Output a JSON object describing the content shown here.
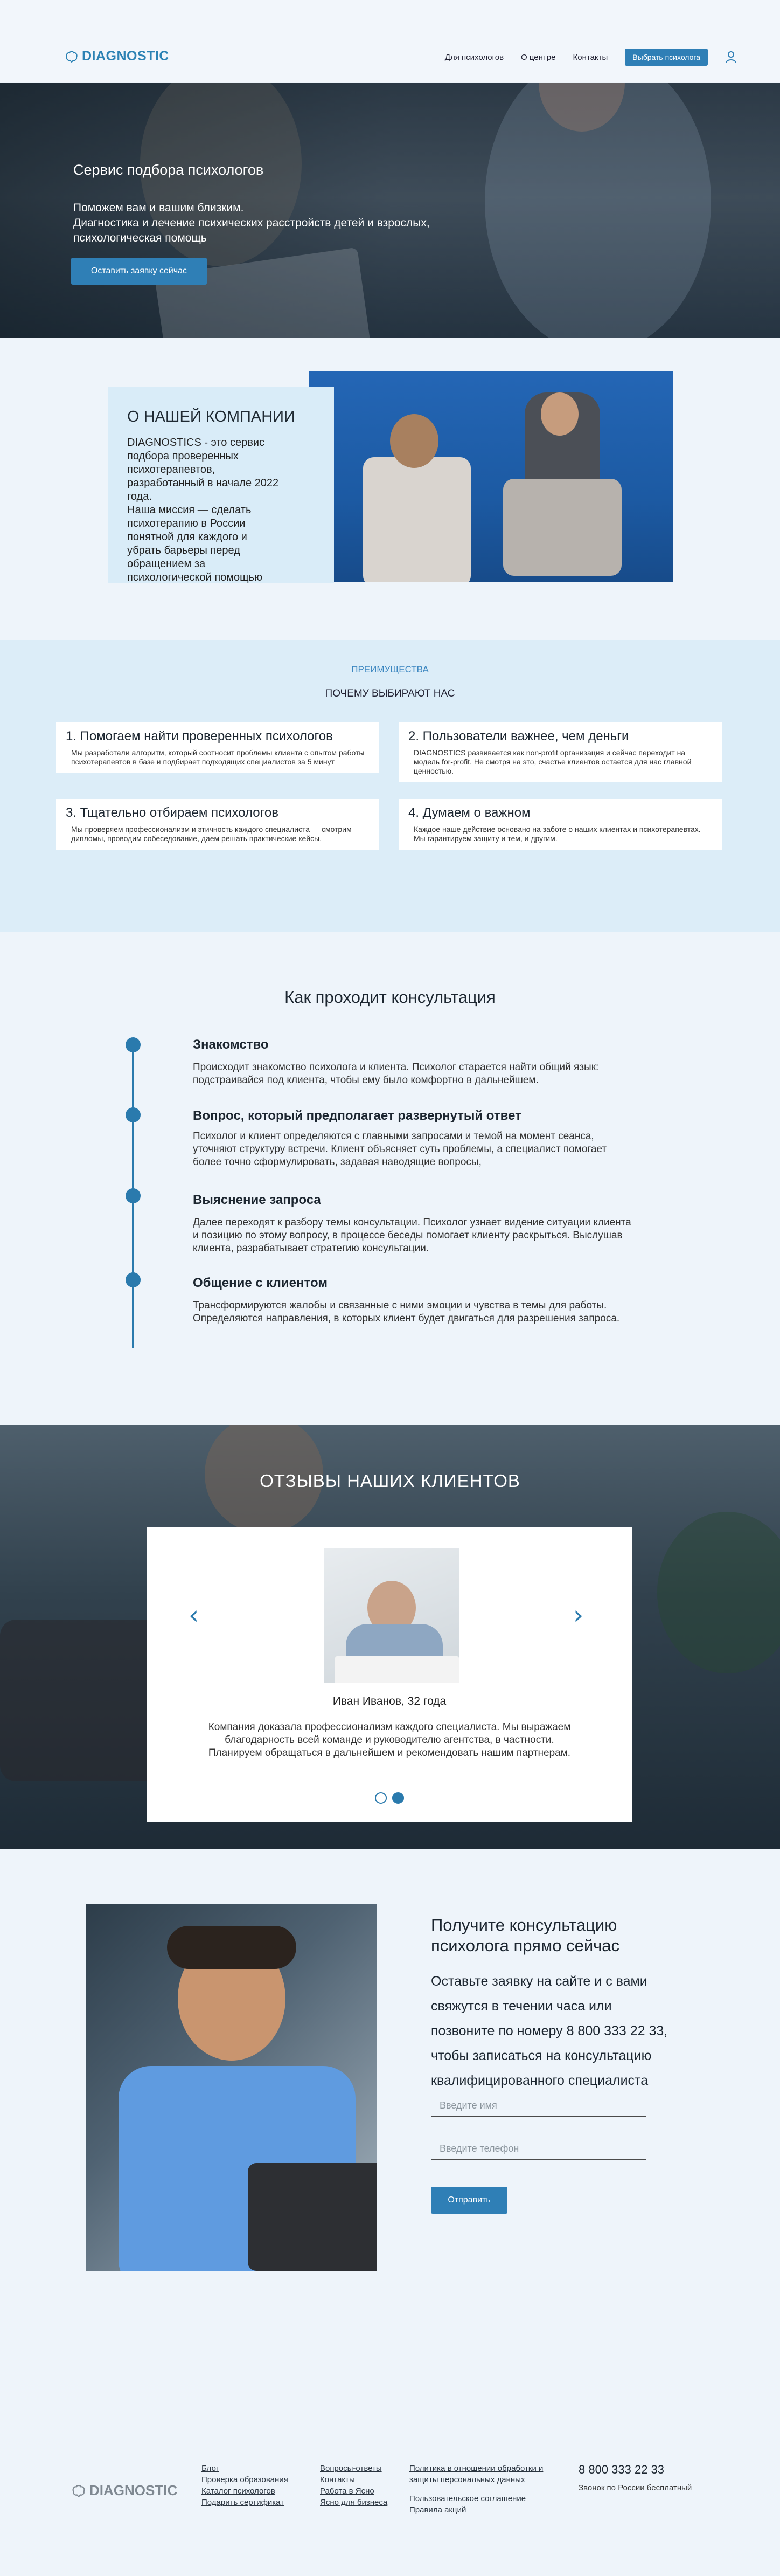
{
  "header": {
    "logo_text": "DIAGNOSTIC",
    "nav": [
      "Для психологов",
      "О центре",
      "Контакты"
    ],
    "cta": "Выбрать психолога",
    "user_icon": "user-icon"
  },
  "hero": {
    "title": "Сервис подбора психологов",
    "subtitle_line1": "Поможем вам и вашим близким.",
    "subtitle_line2": "Диагностика и лечение психических расстройств детей и взрослых,",
    "subtitle_line3": "психологическая помощь",
    "button": "Оставить заявку сейчас"
  },
  "about": {
    "title": "О НАШЕЙ КОМПАНИИ",
    "p1": "DIAGNOSTICS - это сервис подбора проверенных психотерапевтов, разработанный в начале 2022 года.",
    "p2": "Наша миссия — сделать психотерапию в России понятной для каждого и убрать барьеры перед обращением за психологической помощью"
  },
  "advantages": {
    "eyebrow": "ПРЕИМУЩЕСТВА",
    "title": "ПОЧЕМУ ВЫБИРАЮТ НАС",
    "items": [
      {
        "title": "1. Помогаем найти проверенных психологов",
        "text": "Мы разработали алгоритм, который соотносит проблемы клиента с опытом работы психотерапевтов в базе и подбирает подходящих специалистов за 5 минут"
      },
      {
        "title": "2. Пользователи важнее, чем деньги",
        "text": "DIAGNOSTICS развивается как non-profit организация и сейчас переходит на модель for-profit. Не смотря на это, счастье клиентов остается для нас главной ценностью."
      },
      {
        "title": "3. Тщательно отбираем психологов",
        "text": "Мы проверяем профессионализм и этичность каждого специалиста — смотрим дипломы, проводим собеседование, даем решать практические кейсы."
      },
      {
        "title": "4. Думаем о важном",
        "text": "Каждое наше действие основано на заботе о наших клиентах и психотерапевтах. Мы гарантируем защиту и тем, и другим."
      }
    ]
  },
  "consultation": {
    "title": "Как проходит консультация",
    "steps": [
      {
        "title": "Знакомство",
        "text": "Происходит знакомство психолога и клиента. Психолог старается найти общий язык: подстраивайся под клиента, чтобы ему было комфортно в дальнейшем."
      },
      {
        "title": "Вопрос, который предполагает развернутый ответ",
        "text": "Психолог и клиент определяются с главными запросами и темой на момент сеанса, уточняют структуру встречи. Клиент объясняет суть проблемы, а специалист помогает более точно сформулировать, задавая наводящие вопросы,"
      },
      {
        "title": "Выяснение запроса",
        "text": "Далее переходят к разбору темы консультации. Психолог узнает видение ситуации клиента и позицию по этому вопросу, в процессе беседы помогает клиенту раскрыться. Выслушав клиента, разрабатывает стратегию консультации."
      },
      {
        "title": "Общение с клиентом",
        "text": "Трансформируются жалобы и связанные с ними эмоции и чувства в темы для работы. Определяются направления, в которых клиент будет двигаться для разрешения запроса."
      }
    ]
  },
  "reviews": {
    "title": "ОТЗЫВЫ НАШИХ КЛИЕНТОВ",
    "name": "Иван Иванов, 32 года",
    "text": "Компания доказала профессионализм каждого специалиста. Мы выражаем благодарность всей команде и руководителю агентства, в частности. Планируем обращаться в дальнейшем и рекомендовать нашим партнерам.",
    "prev_icon": "chevron-left-icon",
    "next_icon": "chevron-right-icon",
    "active_page": 2,
    "total_pages": 2
  },
  "contact": {
    "title": "Получите консультацию психолога прямо сейчас",
    "text": "Оставьте заявку на сайте и с вами свяжутся в течении часа или позвоните по номеру 8 800 333 22 33, чтобы записаться на консультацию квалифицированного специалиста",
    "name_placeholder": "Введите имя",
    "phone_placeholder": "Введите телефон",
    "button": "Отправить"
  },
  "footer": {
    "logo_text": "DIAGNOSTIC",
    "col1": [
      "Блог",
      "Проверка образования",
      "Каталог психологов",
      "Подарить сертификат"
    ],
    "col2": [
      "Вопросы-ответы",
      "Контакты",
      "Работа в Ясно",
      "Ясно для бизнеса"
    ],
    "col3": [
      "Политика в отношении обработки и защиты персональных данных",
      "Пользовательское соглашение",
      "Правила акций"
    ],
    "phone": "8 800 333 22 33",
    "phone_note": "Звонок по России бесплатный"
  },
  "colors": {
    "accent": "#2f7fb6",
    "light_bg": "#eef4fa",
    "section_bg": "#dcedf8"
  }
}
